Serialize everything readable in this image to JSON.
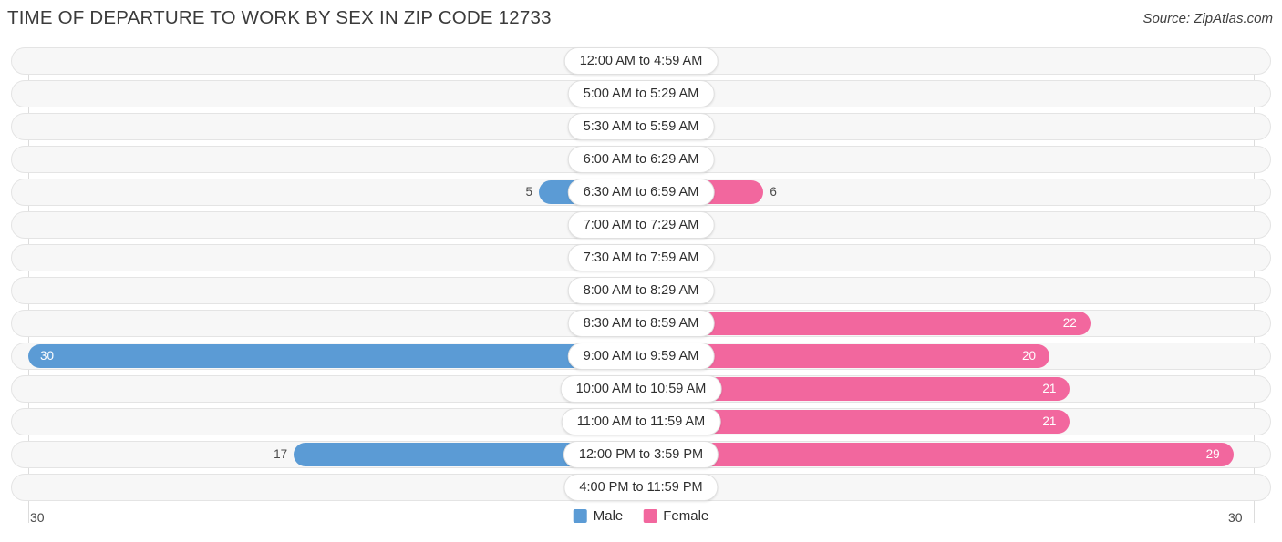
{
  "header": {
    "title": "TIME OF DEPARTURE TO WORK BY SEX IN ZIP CODE 12733",
    "source": "Source: ZipAtlas.com"
  },
  "axis": {
    "left_label": "30",
    "right_label": "30"
  },
  "legend": {
    "items": [
      {
        "label": "Male",
        "color": "#5b9bd5"
      },
      {
        "label": "Female",
        "color": "#f2679e"
      }
    ]
  },
  "colors": {
    "male_strong": "#5b9bd5",
    "male_light": "#a9cae9",
    "female_strong": "#f2679e",
    "female_light": "#f8b0ca",
    "row_background": "#f7f7f7",
    "gridline": "#dcdcdc"
  },
  "chart_data": {
    "type": "bar",
    "title": "TIME OF DEPARTURE TO WORK BY SEX IN ZIP CODE 12733",
    "subtitle": "",
    "xlabel": "",
    "ylabel": "",
    "orientation": "horizontal-diverging",
    "grid": true,
    "legend_position": "bottom-center",
    "xlim": [
      30,
      0,
      30
    ],
    "axis_max": 30,
    "categories": [
      "12:00 AM to 4:59 AM",
      "5:00 AM to 5:29 AM",
      "5:30 AM to 5:59 AM",
      "6:00 AM to 6:29 AM",
      "6:30 AM to 6:59 AM",
      "7:00 AM to 7:29 AM",
      "7:30 AM to 7:59 AM",
      "8:00 AM to 8:29 AM",
      "8:30 AM to 8:59 AM",
      "9:00 AM to 9:59 AM",
      "10:00 AM to 10:59 AM",
      "11:00 AM to 11:59 AM",
      "12:00 PM to 3:59 PM",
      "4:00 PM to 11:59 PM"
    ],
    "series": [
      {
        "name": "Male",
        "color": "#5b9bd5",
        "values": [
          0,
          0,
          0,
          0,
          5,
          0,
          0,
          0,
          0,
          30,
          0,
          0,
          17,
          0
        ]
      },
      {
        "name": "Female",
        "color": "#f2679e",
        "values": [
          0,
          0,
          0,
          0,
          6,
          0,
          0,
          0,
          22,
          20,
          21,
          21,
          29,
          0
        ]
      }
    ]
  }
}
